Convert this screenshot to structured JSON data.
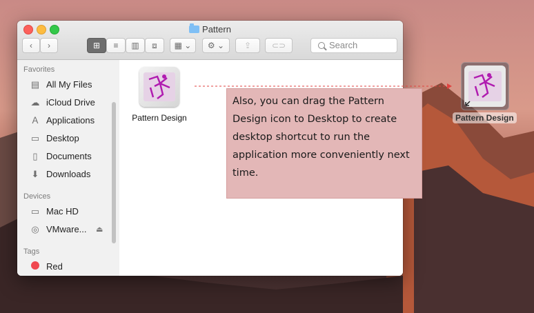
{
  "window": {
    "title": "Pattern",
    "buttons": {
      "back": "‹",
      "forward": "›",
      "view_icons": "⊞",
      "view_list": "≡",
      "view_columns": "▥",
      "view_gallery": "⧈",
      "arrange": "▦ ⌄",
      "action": "⚙ ⌄",
      "share": "⇪",
      "tags": "⊂⊃"
    },
    "search_placeholder": "Search"
  },
  "sidebar": {
    "favorites_header": "Favorites",
    "favorites": [
      {
        "label": "All My Files",
        "icon": "all-files-icon"
      },
      {
        "label": "iCloud Drive",
        "icon": "cloud-icon"
      },
      {
        "label": "Applications",
        "icon": "applications-icon"
      },
      {
        "label": "Desktop",
        "icon": "desktop-icon"
      },
      {
        "label": "Documents",
        "icon": "documents-icon"
      },
      {
        "label": "Downloads",
        "icon": "downloads-icon"
      }
    ],
    "devices_header": "Devices",
    "devices": [
      {
        "label": "Mac HD",
        "icon": "hard-drive-icon"
      },
      {
        "label": "VMware...",
        "icon": "disc-icon"
      }
    ],
    "tags_header": "Tags",
    "tags": [
      {
        "label": "Red",
        "color": "#f0474f"
      }
    ]
  },
  "content": {
    "files": [
      {
        "label": "Pattern Design"
      }
    ]
  },
  "note": {
    "text": "Also, you can drag the Pattern Design icon to Desktop to create desktop shortcut to run the application more conveniently next time."
  },
  "desktop": {
    "shortcut_label": "Pattern Design"
  }
}
